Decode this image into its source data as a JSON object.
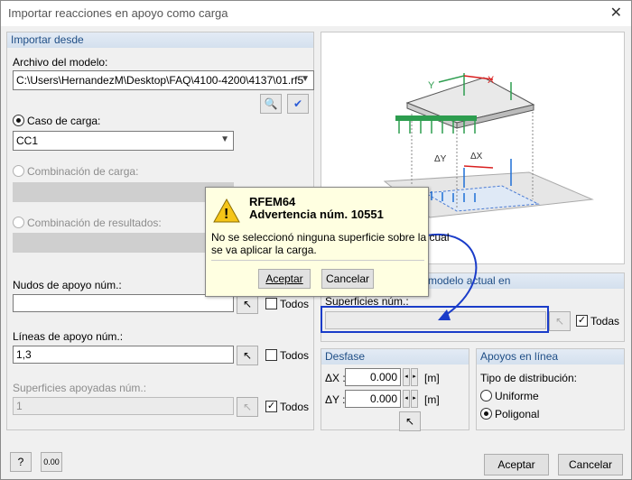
{
  "window": {
    "title": "Importar reacciones en apoyo como carga"
  },
  "import_from": {
    "header": "Importar desde",
    "model_file_label": "Archivo del modelo:",
    "model_file_value": "C:\\Users\\HernandezM\\Desktop\\FAQ\\4100-4200\\4137\\01.rf5",
    "load_case_label": "Caso de carga:",
    "load_case_value": "CC1",
    "load_combo_label": "Combinación de carga:",
    "result_combo_label": "Combinación de resultados:",
    "support_nodes_label": "Nudos de apoyo núm.:",
    "support_nodes_value": "",
    "support_lines_label": "Líneas de apoyo núm.:",
    "support_lines_value": "1,3",
    "supported_surfaces_label": "Superficies apoyadas núm.:",
    "supported_surfaces_value": "1",
    "all_label": "Todos"
  },
  "current_model": {
    "header": "l modelo actual en",
    "surfaces_label": "Superficies núm.:",
    "surfaces_value": "",
    "all_label": "Todas"
  },
  "offset": {
    "header": "Desfase",
    "dx_label": "ΔX :",
    "dx_value": "0.000",
    "dy_label": "ΔY :",
    "dy_value": "0.000",
    "unit": "[m]"
  },
  "line_supports": {
    "header": "Apoyos en línea",
    "dist_label": "Tipo de distribución:",
    "uniform": "Uniforme",
    "polygonal": "Poligonal"
  },
  "diagram": {
    "dy": "ΔY",
    "dx": "ΔX",
    "y": "Y",
    "x": "X"
  },
  "warning": {
    "title": "RFEM64",
    "subtitle": "Advertencia núm. 10551",
    "message_line1": "No se seleccionó ninguna superficie sobre la cual",
    "message_line2": "se va aplicar la carga.",
    "ok": "Aceptar",
    "cancel": "Cancelar"
  },
  "footer": {
    "ok": "Aceptar",
    "cancel": "Cancelar",
    "help_icon": "?",
    "units_icon": "0.00"
  },
  "colors": {
    "highlight": "#1a3cc9",
    "accent_green": "#1f9a4a",
    "accent_red": "#d92020"
  }
}
